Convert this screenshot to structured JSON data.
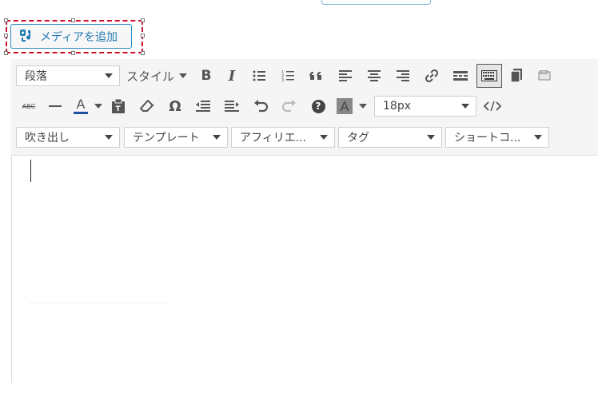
{
  "media_button": {
    "label": "メディアを追加",
    "icon": "media-add-icon"
  },
  "toolbar1": {
    "format_select": "段落",
    "style_menu": "スタイル",
    "icons": [
      "bold-icon",
      "italic-icon",
      "bullet-list-icon",
      "numbered-list-icon",
      "blockquote-icon",
      "align-left-icon",
      "align-center-icon",
      "align-right-icon",
      "link-icon",
      "read-more-icon",
      "toolbar-toggle-icon",
      "copy-icon",
      "paste-icon"
    ]
  },
  "toolbar2": {
    "font_size": "18px",
    "icons": [
      "strikethrough-icon",
      "horizontal-rule-icon",
      "text-color-icon",
      "paste-text-icon",
      "clear-format-icon",
      "special-char-icon",
      "outdent-icon",
      "indent-icon",
      "undo-icon",
      "redo-icon",
      "help-icon",
      "background-color-icon",
      "code-icon"
    ],
    "omega_glyph": "Ω",
    "text_color_glyph": "A",
    "help_glyph": "?",
    "strike_text": "ABC"
  },
  "toolbar3": {
    "selects": [
      "吹き出し",
      "テンプレート",
      "アフィリエ...",
      "タグ",
      "ショートコ..."
    ]
  },
  "colors": {
    "accent": "#2e8cc5",
    "highlight": "#d0112b",
    "text_color_bar": "#1f4fa0"
  }
}
